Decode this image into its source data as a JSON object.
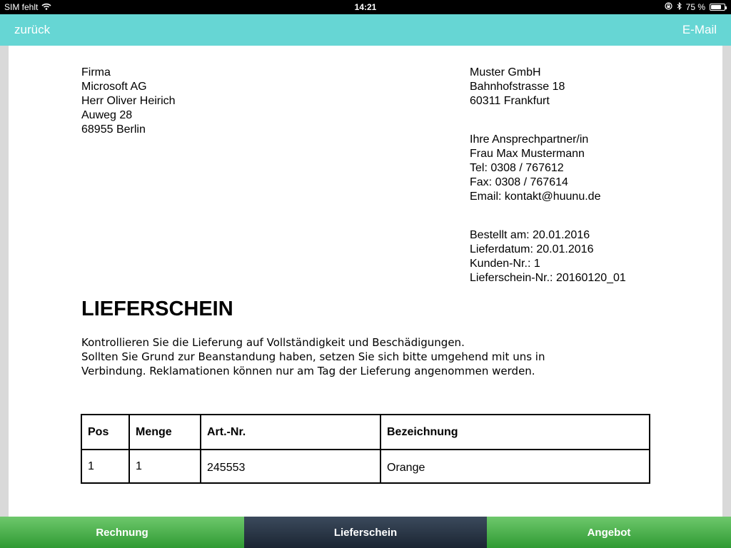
{
  "statusbar": {
    "carrier": "SIM fehlt",
    "time": "14:21",
    "battery": "75 %",
    "battery_level": 0.75
  },
  "nav": {
    "back_label": "zurück",
    "email_label": "E-Mail"
  },
  "document": {
    "recipient": [
      "Firma",
      "Microsoft AG",
      "Herr Oliver Heirich",
      "Auweg 28",
      "68955 Berlin"
    ],
    "sender": [
      "Muster GmbH",
      "Bahnhofstrasse 18",
      "60311 Frankfurt"
    ],
    "contact": [
      "Ihre Ansprechpartner/in",
      "Frau Max Mustermann",
      "Tel: 0308 / 767612",
      "Fax: 0308 / 767614",
      "Email: kontakt@huunu.de"
    ],
    "order": [
      "Bestellt am: 20.01.2016",
      "Lieferdatum: 20.01.2016",
      "Kunden-Nr.: 1",
      "Lieferschein-Nr.: 20160120_01"
    ],
    "title": "LIEFERSCHEIN",
    "intro": [
      "Kontrollieren Sie die Lieferung auf Vollständigkeit und Beschädigungen.",
      "Sollten Sie Grund zur Beanstandung haben, setzen Sie sich bitte umgehend mit uns in",
      "Verbindung. Reklamationen können nur am Tag der Lieferung angenommen werden."
    ],
    "table": {
      "headers": [
        "Pos",
        "Menge",
        "Art.-Nr.",
        "Bezeichnung"
      ],
      "rows": [
        [
          "1",
          "1",
          "245553",
          "Orange"
        ]
      ]
    }
  },
  "tabs": [
    {
      "label": "Rechnung",
      "active": false
    },
    {
      "label": "Lieferschein",
      "active": true
    },
    {
      "label": "Angebot",
      "active": false
    }
  ]
}
